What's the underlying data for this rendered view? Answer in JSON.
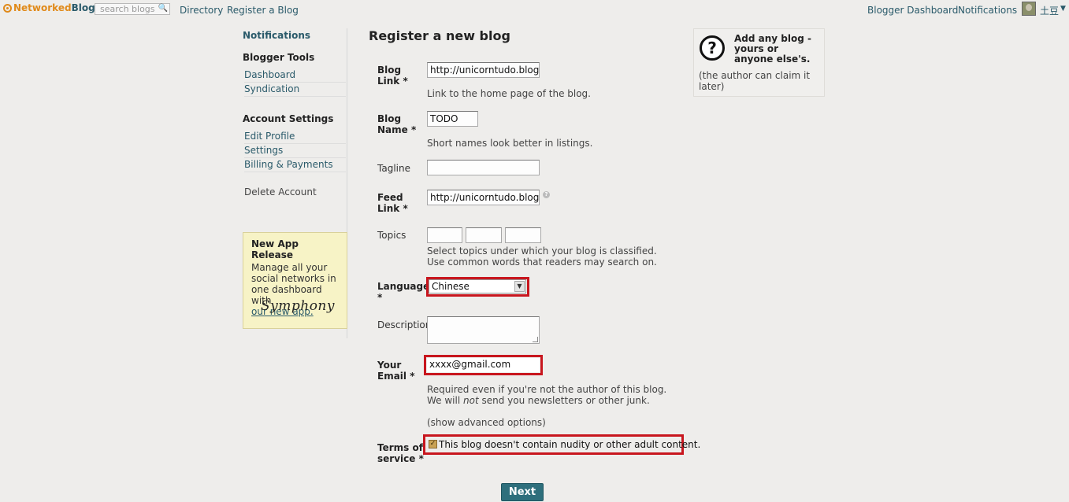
{
  "topbar": {
    "brand_prefix": "Networked",
    "brand_suffix": "Blogs",
    "search_placeholder": "search blogs",
    "nav": [
      "Directory",
      "Register a Blog"
    ],
    "right_links": [
      "Blogger Dashboard",
      "Notifications"
    ],
    "username": "土豆"
  },
  "sidebar": {
    "notifications": "Notifications",
    "blogger_tools": "Blogger Tools",
    "tools": [
      "Dashboard",
      "Syndication"
    ],
    "account_settings": "Account Settings",
    "account": [
      "Edit Profile",
      "Settings",
      "Billing & Payments"
    ],
    "delete_account": "Delete Account"
  },
  "promo": {
    "title": "New App Release",
    "text": "Manage all your social networks in one dashboard with",
    "link": "our new app.",
    "signature": "Symphony"
  },
  "form": {
    "title": "Register a new blog",
    "blog_link": {
      "label1": "Blog",
      "label2": "Link *",
      "value": "http://unicorntudo.blogspot",
      "hint": "Link to the home page of the blog."
    },
    "blog_name": {
      "label1": "Blog",
      "label2": "Name *",
      "value": "TODO",
      "hint": "Short names look better in listings."
    },
    "tagline": {
      "label": "Tagline",
      "value": ""
    },
    "feed_link": {
      "label1": "Feed",
      "label2": "Link *",
      "value": "http://unicorntudo.blogspot",
      "help": "?"
    },
    "topics": {
      "label": "Topics",
      "hint1": "Select topics under which your blog is classified.",
      "hint2": "Use common words that readers may search on."
    },
    "language": {
      "label1": "Language",
      "label2": "*",
      "value": "Chinese"
    },
    "description": {
      "label": "Description"
    },
    "email": {
      "label1": "Your",
      "label2": "Email *",
      "value": "xxxx@gmail.com",
      "hint1": "Required even if you're not the author of this blog.",
      "hint2_pre": "We will ",
      "hint2_em": "not",
      "hint2_post": " send you newsletters or other junk."
    },
    "advanced": "(show advanced options)",
    "terms": {
      "label1": "Terms of",
      "label2": "service *",
      "text": "This blog doesn't contain nudity or other adult content.",
      "checked": true
    },
    "next_label": "Next"
  },
  "info": {
    "title": "Add any blog - yours or anyone else's.",
    "note": "(the author can claim it later)"
  },
  "colors": {
    "accent": "#2e6f7c",
    "highlight": "#c8161e",
    "background": "#eeedeb"
  }
}
